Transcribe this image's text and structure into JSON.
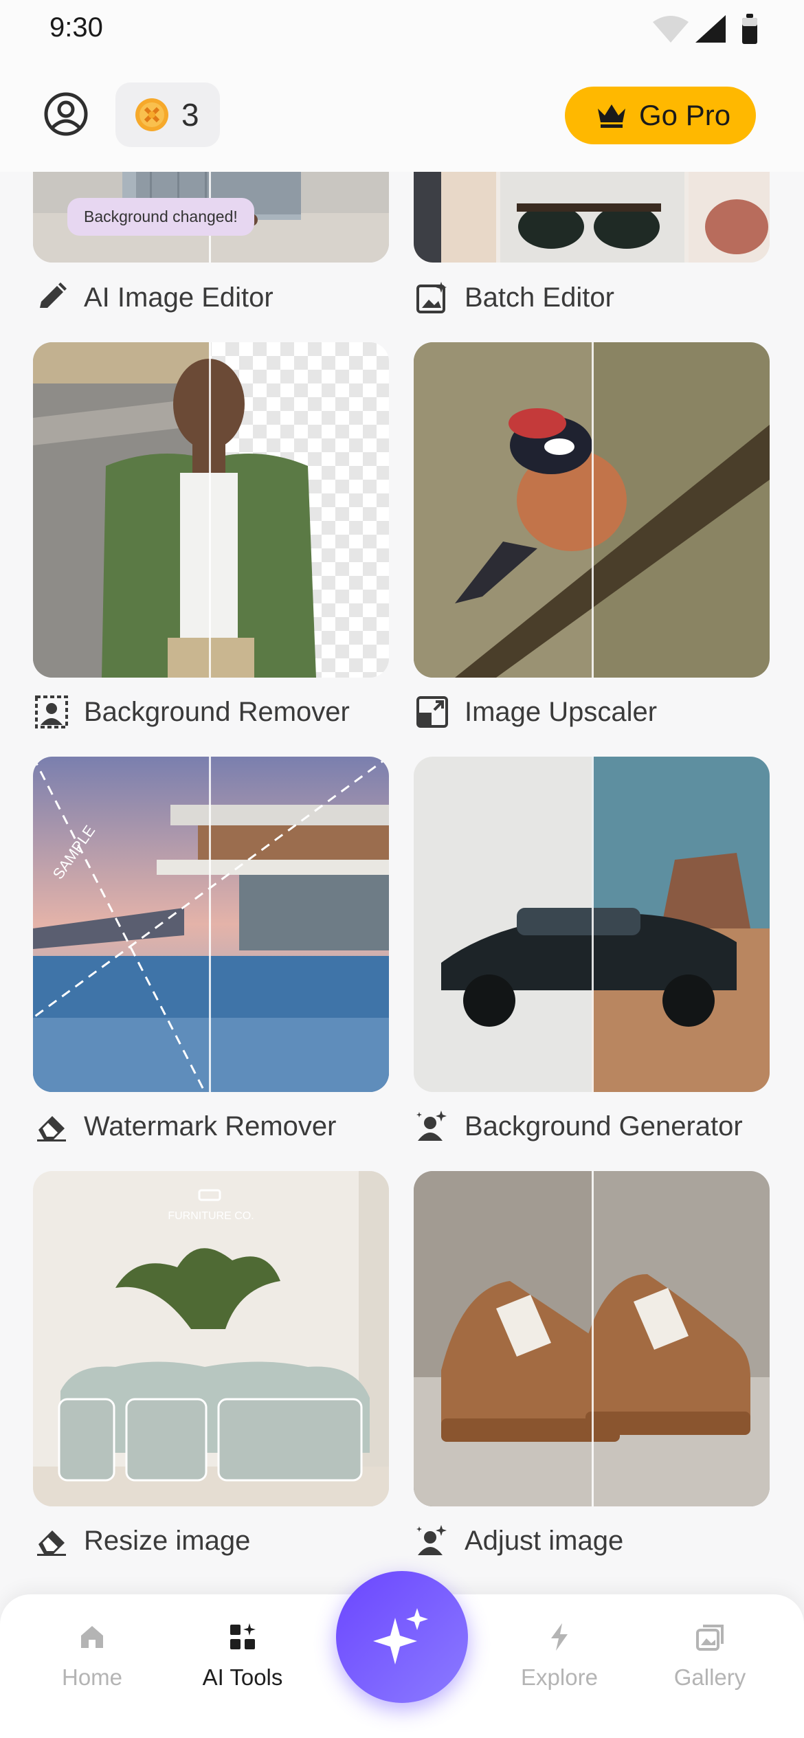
{
  "status_bar": {
    "time": "9:30"
  },
  "header": {
    "credits_count": "3",
    "go_pro_label": "Go Pro",
    "accent_color": "#ffb800"
  },
  "tools": [
    {
      "label": "AI Image Editor",
      "icon": "pencil-icon",
      "badge": "Background changed!"
    },
    {
      "label": "Batch Editor",
      "icon": "image-sparkle-icon"
    },
    {
      "label": "Background Remover",
      "icon": "person-background-icon"
    },
    {
      "label": "Image Upscaler",
      "icon": "expand-image-icon"
    },
    {
      "label": "Watermark Remover",
      "icon": "eraser-icon"
    },
    {
      "label": "Background Generator",
      "icon": "person-sparkle-icon"
    },
    {
      "label": "Resize image",
      "icon": "eraser-icon"
    },
    {
      "label": "Adjust image",
      "icon": "person-sparkle-icon"
    }
  ],
  "card_images": {
    "watermark_text": "SAMPLE",
    "furniture_brand": "FURNITURE CO."
  },
  "bottom_nav": {
    "items": [
      {
        "label": "Home",
        "icon": "home-icon"
      },
      {
        "label": "AI Tools",
        "icon": "apps-icon"
      },
      {
        "label": "Explore",
        "icon": "lightning-icon"
      },
      {
        "label": "Gallery",
        "icon": "gallery-icon"
      }
    ],
    "active": "AI Tools",
    "fab_icon": "sparkle-icon",
    "fab_color": "#6b46ff"
  }
}
